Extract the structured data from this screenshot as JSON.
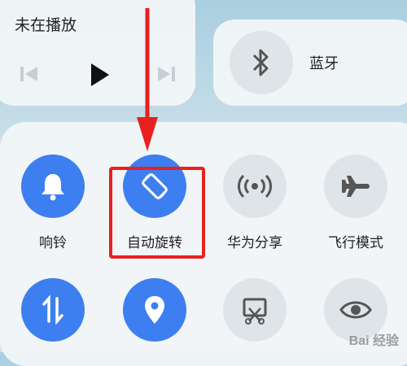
{
  "media": {
    "status_text": "未在播放"
  },
  "bluetooth": {
    "label": "蓝牙"
  },
  "toggles": [
    {
      "label": "响铃",
      "icon": "bell-icon",
      "state": "on"
    },
    {
      "label": "自动旋转",
      "icon": "auto-rotate-icon",
      "state": "on"
    },
    {
      "label": "华为分享",
      "icon": "huawei-share-icon",
      "state": "off"
    },
    {
      "label": "飞行模式",
      "icon": "airplane-icon",
      "state": "off"
    },
    {
      "label": "",
      "icon": "mobile-data-icon",
      "state": "on"
    },
    {
      "label": "",
      "icon": "location-icon",
      "state": "on"
    },
    {
      "label": "",
      "icon": "screenshot-icon",
      "state": "off"
    },
    {
      "label": "",
      "icon": "eye-comfort-icon",
      "state": "off"
    }
  ],
  "annotation": {
    "color": "#e8201f"
  },
  "watermark": {
    "text": "Bai 经验"
  },
  "colors": {
    "active": "#3d7ff0",
    "inactive": "#dfe4e8"
  }
}
